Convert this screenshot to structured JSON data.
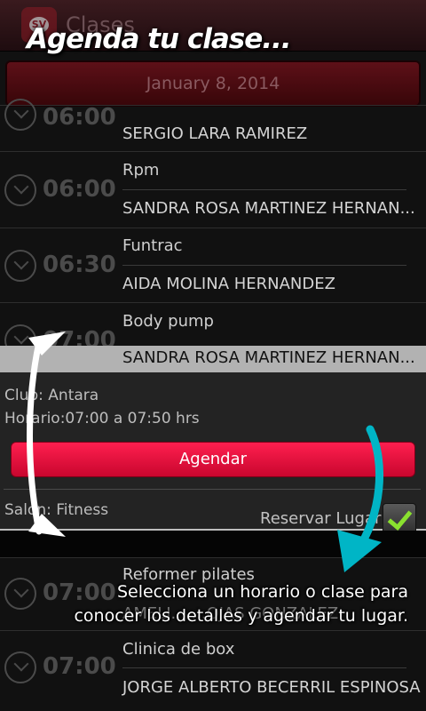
{
  "app": {
    "icon_text": "SV",
    "title": "Clases"
  },
  "overlay_title": "Agenda tu clase...",
  "date": "January 8, 2014",
  "rows": [
    {
      "time": "06:00",
      "class": "",
      "instructor": "SERGIO LARA RAMIREZ"
    },
    {
      "time": "06:00",
      "class": "Rpm",
      "instructor": "SANDRA ROSA MARTINEZ HERNAN..."
    },
    {
      "time": "06:30",
      "class": "Funtrac",
      "instructor": "AIDA MOLINA HERNANDEZ"
    },
    {
      "time": "07:00",
      "class": "Body pump",
      "instructor": "SANDRA ROSA MARTINEZ HERNAN..."
    },
    {
      "time": "07:00",
      "class": "Reformer pilates",
      "instructor": "AMELI... ...OJAS GONZALEZ"
    },
    {
      "time": "07:00",
      "class": "Clinica de box",
      "instructor": "JORGE ALBERTO BECERRIL ESPINOSA"
    }
  ],
  "detail": {
    "club": "Club: Antara",
    "horario": "Horario:07:00 a 07:50 hrs",
    "button": "Agendar",
    "salon": "Salón: Fitness",
    "reservar": "Reservar Lugar",
    "reservar_checked": true
  },
  "callout": {
    "line1": "Selecciona un horario o clase para",
    "line2": "conocer los detalles y agendar tu lugar."
  },
  "colors": {
    "accent": "#e8103c",
    "highlight": "#b2b2b2",
    "arrow": "#00b5c6",
    "check": "#8ae12f"
  }
}
